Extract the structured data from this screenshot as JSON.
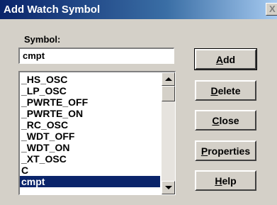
{
  "window": {
    "title": "Add Watch Symbol",
    "close_glyph": "X"
  },
  "symbol_field": {
    "label": "Symbol:",
    "value": "cmpt"
  },
  "list": {
    "items": [
      "_HS_OSC",
      "_LP_OSC",
      "_PWRTE_OFF",
      "_PWRTE_ON",
      "_RC_OSC",
      "_WDT_OFF",
      "_WDT_ON",
      "_XT_OSC",
      "C",
      "cmpt"
    ],
    "selected": "cmpt"
  },
  "buttons": {
    "add": {
      "mnemonic": "A",
      "rest": "dd"
    },
    "delete": {
      "mnemonic": "D",
      "rest": "elete"
    },
    "close": {
      "mnemonic": "C",
      "rest": "lose"
    },
    "properties": {
      "mnemonic": "P",
      "rest": "roperties"
    },
    "help": {
      "mnemonic": "H",
      "rest": "elp"
    }
  },
  "colors": {
    "titlebar_start": "#0a246a",
    "titlebar_end": "#a6caf0",
    "dialog_face": "#d4d0c8",
    "selection": "#0a246a"
  },
  "icons": {
    "close": "close-icon",
    "scroll_up": "arrow-up-icon",
    "scroll_down": "arrow-down-icon"
  }
}
